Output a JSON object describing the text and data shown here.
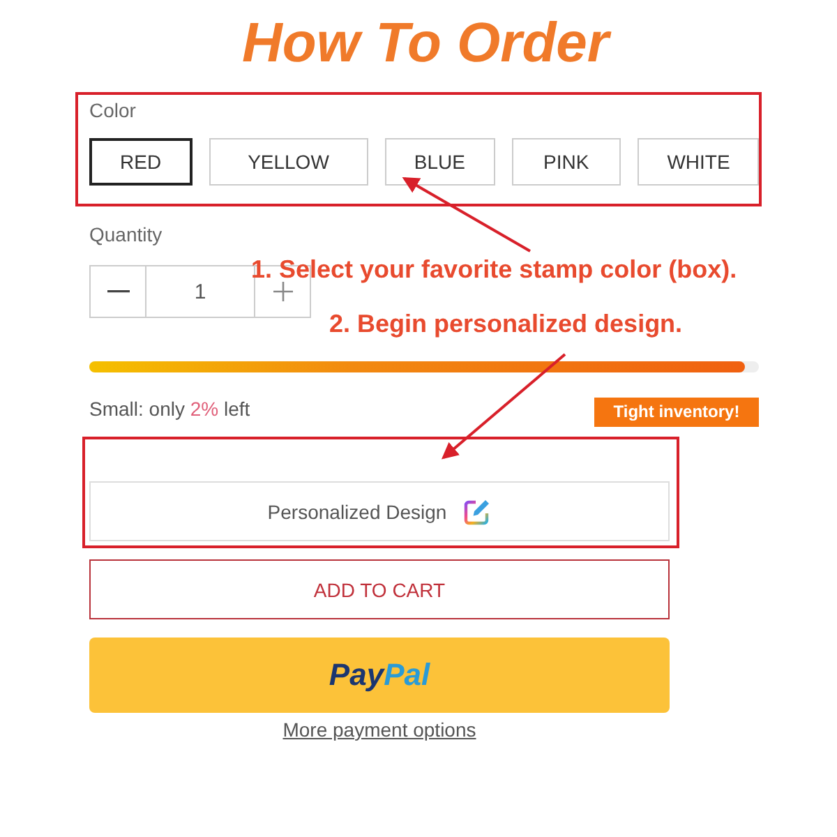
{
  "title": "How To Order",
  "color": {
    "label": "Color",
    "options": [
      {
        "label": "RED",
        "selected": true
      },
      {
        "label": "YELLOW",
        "selected": false
      },
      {
        "label": "BLUE",
        "selected": false
      },
      {
        "label": "PINK",
        "selected": false
      },
      {
        "label": "WHITE",
        "selected": false
      }
    ]
  },
  "quantity": {
    "label": "Quantity",
    "value": "1"
  },
  "stock": {
    "level": 0.98,
    "prefix": "Small: only ",
    "highlight": "2%",
    "suffix": " left",
    "badge": "Tight inventory!"
  },
  "personalize_button": "Personalized Design",
  "add_to_cart_button": "ADD TO CART",
  "paypal_button": {
    "pay": "Pay",
    "pal": "Pal"
  },
  "more_payment_link": "More payment options",
  "annotations": [
    {
      "text": "1. Select your favorite stamp color (box)."
    },
    {
      "text": "2. Begin personalized design."
    }
  ]
}
